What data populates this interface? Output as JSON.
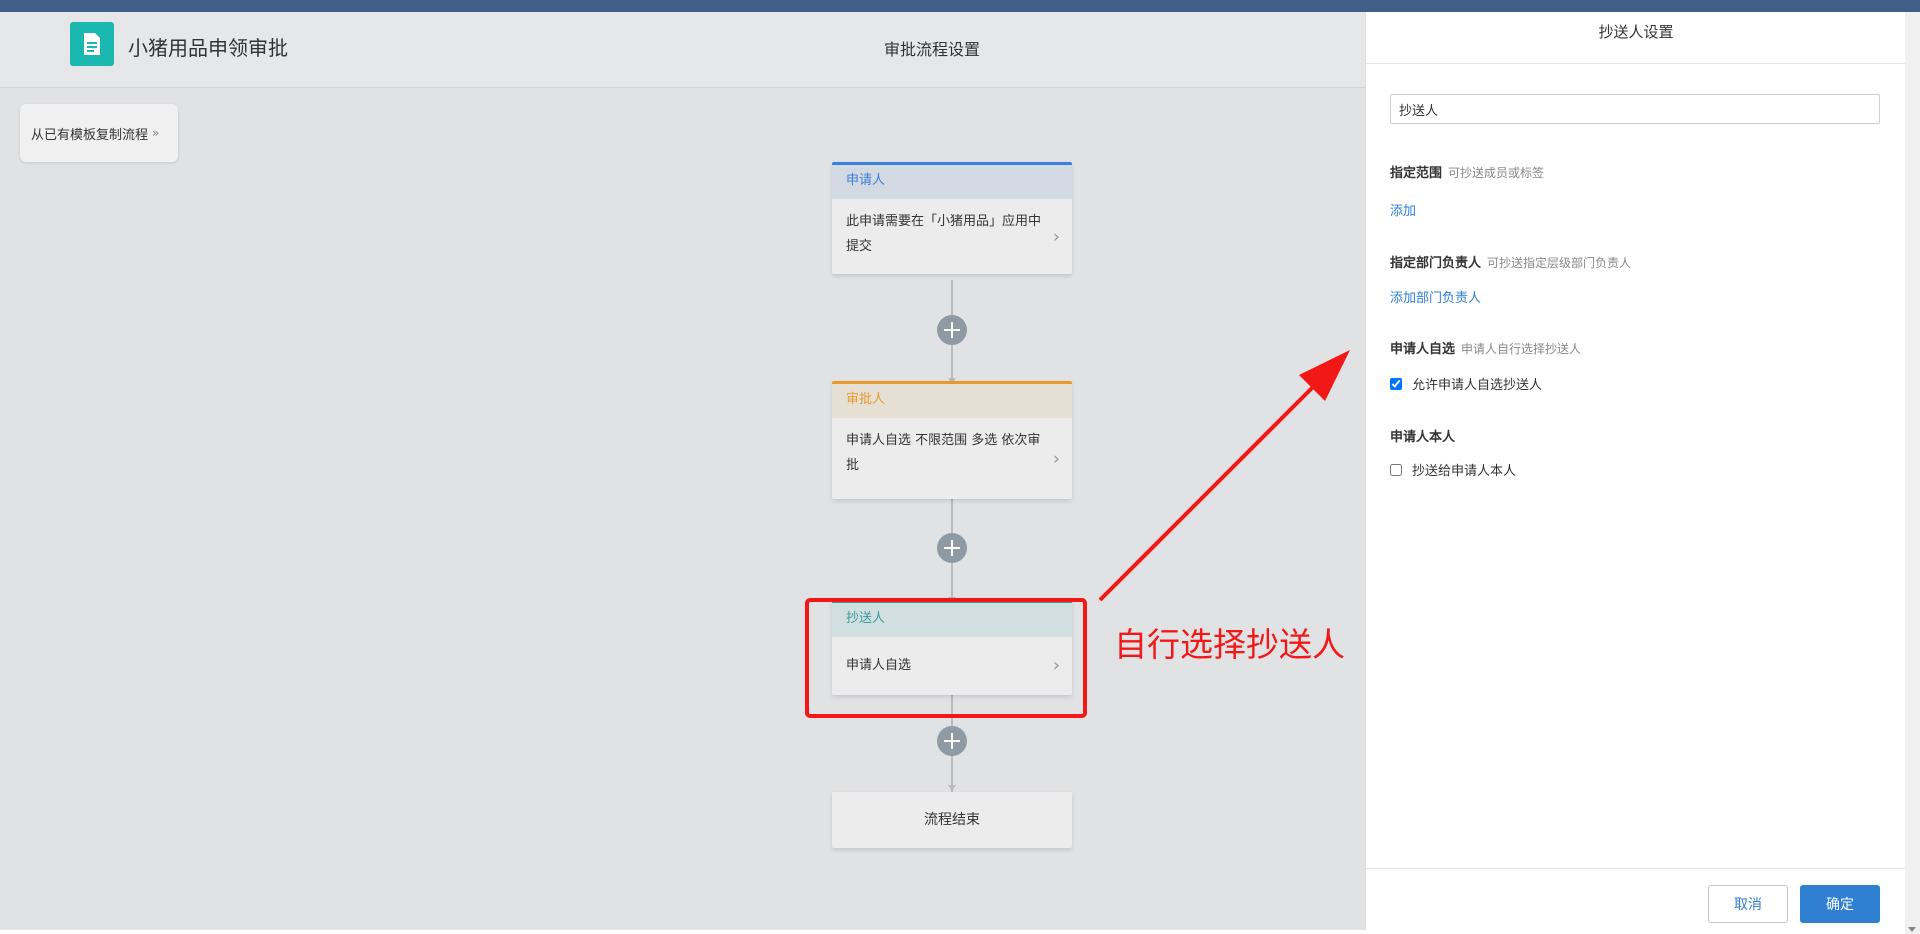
{
  "app": {
    "title": "小猪用品申领审批",
    "page_title": "审批流程设置",
    "icon": "document-icon",
    "accent_color": "#1ab8b0"
  },
  "toolbar": {
    "template_copy_label": "从已有模板复制流程",
    "template_copy_chevron": "»"
  },
  "flow": {
    "nodes": [
      {
        "header": "申请人",
        "body": "此申请需要在「小猪用品」应用中提交",
        "color": "#3b7fd9",
        "head_bg": "#d3d9e2"
      },
      {
        "header": "审批人",
        "body": "申请人自选 不限范围 多选 依次审批",
        "color": "#e89a2b",
        "head_bg": "#e6e0d4"
      },
      {
        "header": "抄送人",
        "body": "申请人自选",
        "color": "#3a9a9a",
        "head_bg": "#d2dfe0"
      }
    ],
    "end_label": "流程结束"
  },
  "annotation": {
    "text": "自行选择抄送人",
    "color": "#f21818"
  },
  "panel": {
    "title": "抄送人设置",
    "name_input_value": "抄送人",
    "scope": {
      "label": "指定范围",
      "hint": "可抄送成员或标签",
      "link": "添加"
    },
    "dept_head": {
      "label": "指定部门负责人",
      "hint": "可抄送指定层级部门负责人",
      "link": "添加部门负责人"
    },
    "self_select": {
      "label": "申请人自选",
      "hint": "申请人自行选择抄送人",
      "checkbox_label": "允许申请人自选抄送人",
      "checked": true
    },
    "self": {
      "label": "申请人本人",
      "checkbox_label": "抄送给申请人本人",
      "checked": false
    },
    "cancel_label": "取消",
    "ok_label": "确定",
    "link_color": "#2f7fd3"
  }
}
